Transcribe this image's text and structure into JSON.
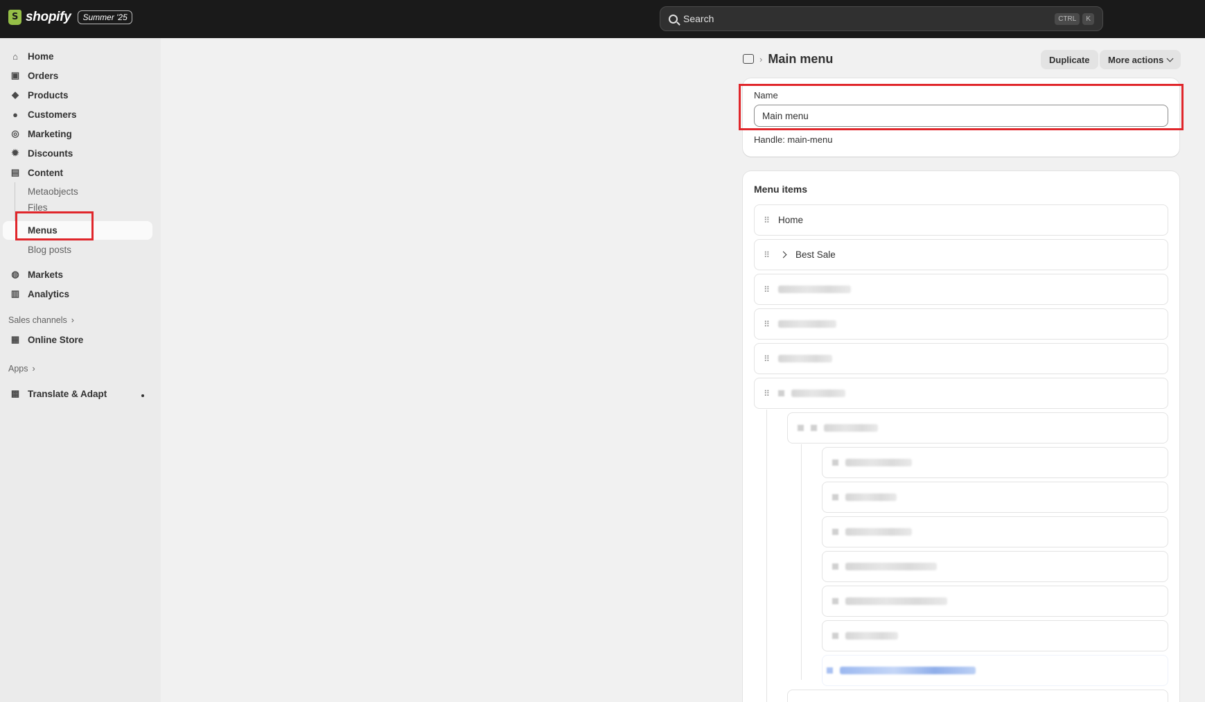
{
  "topbar": {
    "brand": "shopify",
    "edition_badge": "Summer '25",
    "search_placeholder": "Search",
    "shortcut_keys": [
      "CTRL",
      "K"
    ]
  },
  "sidebar": {
    "items": [
      {
        "label": "Home",
        "icon": "home-icon"
      },
      {
        "label": "Orders",
        "icon": "inbox-icon"
      },
      {
        "label": "Products",
        "icon": "tag-icon"
      },
      {
        "label": "Customers",
        "icon": "person-icon"
      },
      {
        "label": "Marketing",
        "icon": "target-icon"
      },
      {
        "label": "Discounts",
        "icon": "discount-icon"
      },
      {
        "label": "Content",
        "icon": "content-icon"
      }
    ],
    "content_subitems": [
      "Metaobjects",
      "Files",
      "Menus",
      "Blog posts"
    ],
    "active_item": "Menus",
    "more_items": [
      {
        "label": "Markets",
        "icon": "globe-icon"
      },
      {
        "label": "Analytics",
        "icon": "bar-chart-icon"
      }
    ],
    "sales_channels_label": "Sales channels",
    "online_store_label": "Online Store",
    "apps_label": "Apps",
    "translate_label": "Translate & Adapt"
  },
  "header": {
    "title": "Main menu",
    "duplicate_label": "Duplicate",
    "more_actions_label": "More actions"
  },
  "name_card": {
    "name_label": "Name",
    "name_value": "Main menu",
    "handle_text": "Handle: main-menu"
  },
  "menu_items_card": {
    "title": "Menu items",
    "items": [
      {
        "label": "Home"
      },
      {
        "label": "Best Sale",
        "expandable": true
      }
    ]
  },
  "colors": {
    "topbar_bg": "#1a1a1a",
    "highlight_box": "#e0262b",
    "brand_green": "#95bf47"
  }
}
